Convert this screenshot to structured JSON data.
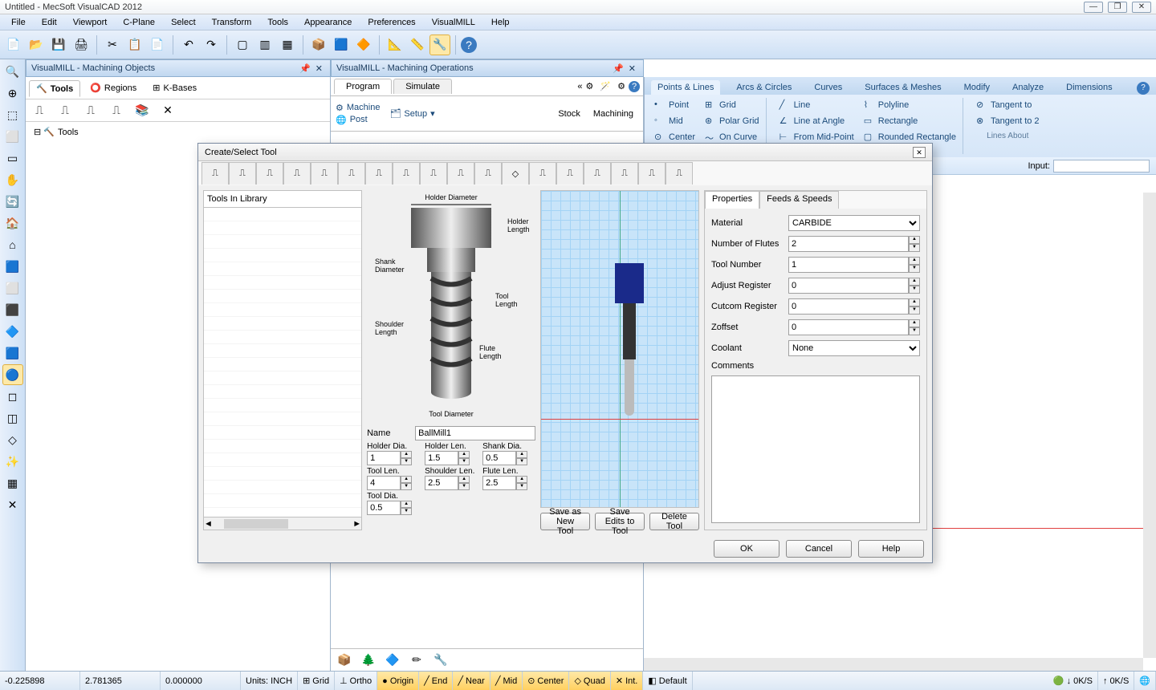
{
  "title": "Untitled - MecSoft VisualCAD 2012",
  "menu": [
    "File",
    "Edit",
    "Viewport",
    "C-Plane",
    "Select",
    "Transform",
    "Tools",
    "Appearance",
    "Preferences",
    "VisualMILL",
    "Help"
  ],
  "panels": {
    "mo_title": "VisualMILL - Machining Objects",
    "ops_title": "VisualMILL - Machining Operations",
    "mo_tabs": {
      "tools": "Tools",
      "regions": "Regions",
      "kbases": "K-Bases"
    },
    "ops_tabs": {
      "program": "Program",
      "simulate": "Simulate"
    },
    "ops_buttons": {
      "machine": "Machine",
      "setup": "Setup",
      "post": "Post",
      "stock": "Stock",
      "machining": "Machining"
    },
    "tree_root": "Tools"
  },
  "ribbon": {
    "tabs": [
      "Points & Lines",
      "Arcs & Circles",
      "Curves",
      "Surfaces & Meshes",
      "Modify",
      "Analyze",
      "Dimensions"
    ],
    "col1": [
      "Point",
      "Mid",
      "Center"
    ],
    "col2": [
      "Grid",
      "Polar Grid",
      "On Curve"
    ],
    "col3": [
      "Line",
      "Line at Angle",
      "From Mid-Point"
    ],
    "col4": [
      "Polyline",
      "Rectangle",
      "Rounded Rectangle"
    ],
    "col5": [
      "Tangent to",
      "Tangent to 2"
    ],
    "group_label": "Lines About",
    "input_label": "Input:"
  },
  "dialog": {
    "title": "Create/Select Tool",
    "lib_header": "Tools In Library",
    "diagram_labels": {
      "holder_dia": "Holder Diameter",
      "holder_len": "Holder\nLength",
      "shank_dia": "Shank\nDiameter",
      "tool_len": "Tool\nLength",
      "shoulder_len": "Shoulder\nLength",
      "flute_len": "Flute\nLength",
      "tool_dia": "Tool Diameter"
    },
    "name_label": "Name",
    "name_value": "BallMill1",
    "fields": {
      "holder_dia": {
        "label": "Holder Dia.",
        "value": "1"
      },
      "holder_len": {
        "label": "Holder Len.",
        "value": "1.5"
      },
      "shank_dia": {
        "label": "Shank Dia.",
        "value": "0.5"
      },
      "tool_len": {
        "label": "Tool Len.",
        "value": "4"
      },
      "shoulder_len": {
        "label": "Shoulder Len.",
        "value": "2.5"
      },
      "flute_len": {
        "label": "Flute Len.",
        "value": "2.5"
      },
      "tool_dia": {
        "label": "Tool Dia.",
        "value": "0.5"
      }
    },
    "props_tabs": {
      "properties": "Properties",
      "feeds": "Feeds & Speeds"
    },
    "props": {
      "material_label": "Material",
      "material_value": "CARBIDE",
      "flutes_label": "Number of Flutes",
      "flutes_value": "2",
      "toolnum_label": "Tool Number",
      "toolnum_value": "1",
      "adjreg_label": "Adjust Register",
      "adjreg_value": "0",
      "cutcom_label": "Cutcom Register",
      "cutcom_value": "0",
      "zoff_label": "Zoffset",
      "zoff_value": "0",
      "coolant_label": "Coolant",
      "coolant_value": "None",
      "comments_label": "Comments"
    },
    "buttons": {
      "save_new": "Save as New Tool",
      "save_edits": "Save Edits to Tool",
      "delete": "Delete Tool",
      "ok": "OK",
      "cancel": "Cancel",
      "help": "Help"
    }
  },
  "status": {
    "x": "-0.225898",
    "y": "2.781365",
    "z": "0.000000",
    "units": "Units: INCH",
    "snaps": [
      "Grid",
      "Ortho",
      "Origin",
      "End",
      "Near",
      "Mid",
      "Center",
      "Quad",
      "Int."
    ],
    "default": "Default",
    "rate1": "0K/S",
    "rate2": "0K/S"
  }
}
